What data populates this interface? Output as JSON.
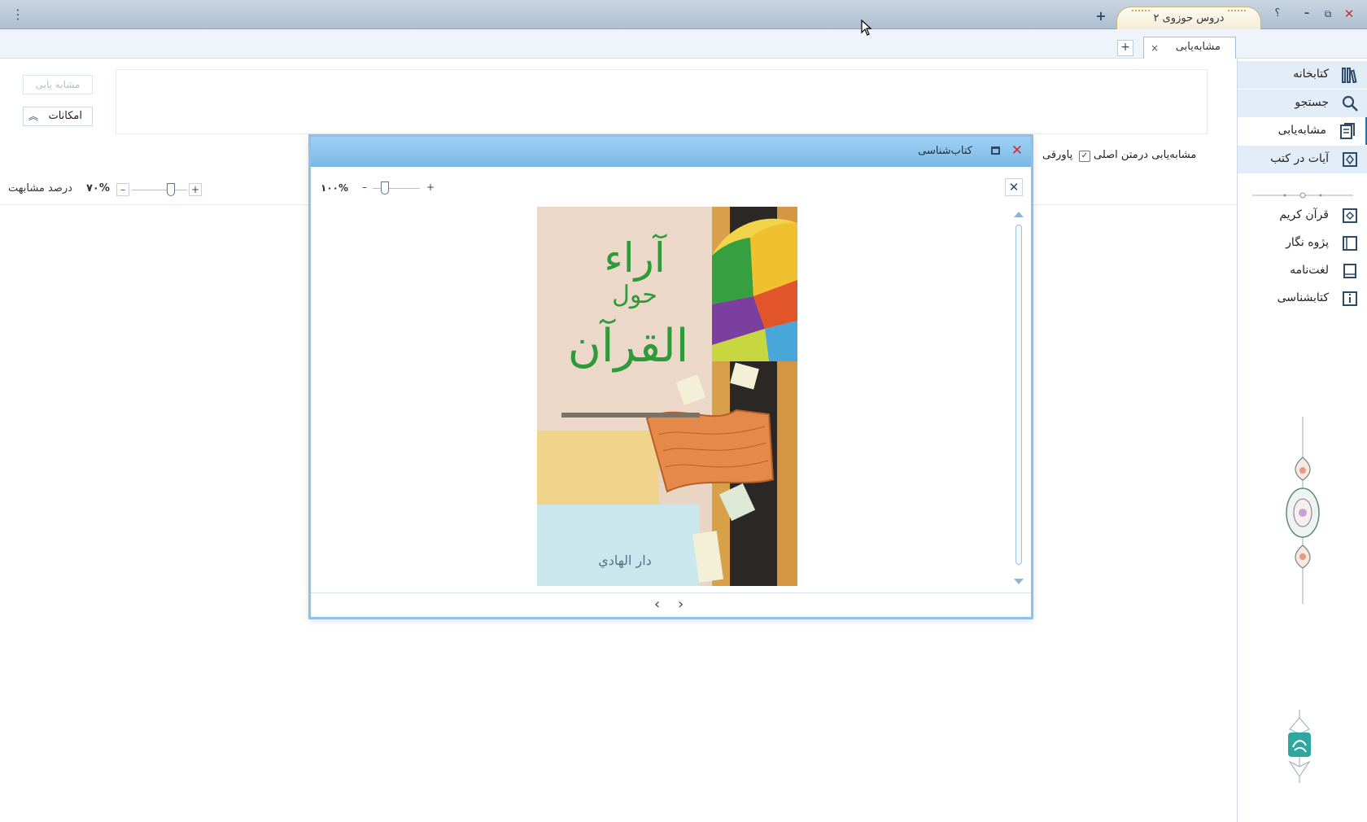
{
  "window": {
    "menu_icon": "⋮",
    "doc_tab_title": "دروس حوزوی ۲",
    "new_tab": "+",
    "controls": {
      "help": "؟",
      "minimize": "–",
      "restore": "⧉",
      "close": "✕"
    }
  },
  "page_tabs": {
    "active_label": "مشابه‌یابی",
    "close": "×",
    "add": "+"
  },
  "sidebar": {
    "items": [
      {
        "label": "کتابخانه",
        "icon": "library-icon"
      },
      {
        "label": "جستجو",
        "icon": "search-icon"
      },
      {
        "label": "مشابه‌یابی",
        "icon": "similarity-icon"
      },
      {
        "label": "آیات در کتب",
        "icon": "verses-icon"
      },
      {
        "label": "قرآن کریم",
        "icon": "quran-icon"
      },
      {
        "label": "پژوه نگار",
        "icon": "research-notebook-icon"
      },
      {
        "label": "لغت‌نامه",
        "icon": "dictionary-icon"
      },
      {
        "label": "کتابشناسی",
        "icon": "bibliography-icon"
      }
    ]
  },
  "toolbar": {
    "similarity_button": "مشابه یابی",
    "options_button": "امکانات",
    "search_in_label": "مشابه‌یابی در",
    "main_text_label": "متن اصلی",
    "footnote_label": "پاورقی",
    "similarity_percent_label": "درصد مشابهت",
    "similarity_percent_value": "۷۰%",
    "similarity_level": 0.7,
    "plus": "+",
    "minus": "–"
  },
  "dialog": {
    "title": "کتاب‌شناسی",
    "close": "✕",
    "inner_close": "✕",
    "zoom_value": "۱۰۰%",
    "zoom_level": 0.25,
    "plus": "+",
    "minus": "–",
    "prev": "‹",
    "next": "›",
    "cover": {
      "title_line1": "آراء",
      "title_line2": "حول",
      "title_line3": "القرآن",
      "publisher": "دار الهادي"
    }
  },
  "colors": {
    "accent": "#2c6db0",
    "dialog_title": "#8dc0ea",
    "close_red": "#d42a2a",
    "cover_green": "#2e9a3a"
  }
}
